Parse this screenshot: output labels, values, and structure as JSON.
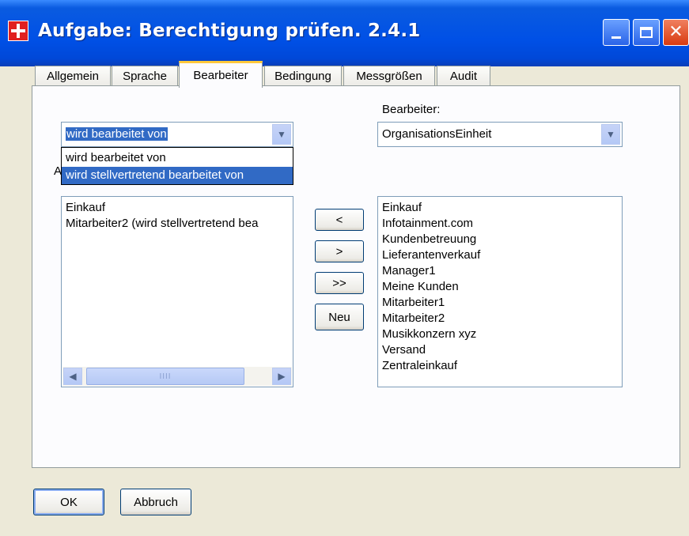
{
  "window": {
    "title": "Aufgabe: Berechtigung prüfen. 2.4.1",
    "controls": {
      "minimize_icon": "minimize-icon",
      "maximize_icon": "maximize-icon",
      "close_icon": "close-icon",
      "close_glyph": "✕"
    }
  },
  "tabs": [
    {
      "label": "Allgemein",
      "active": false
    },
    {
      "label": "Sprache",
      "active": false
    },
    {
      "label": "Bearbeiter",
      "active": true
    },
    {
      "label": "Bedingung",
      "active": false
    },
    {
      "label": "Messgrößen",
      "active": false
    },
    {
      "label": "Audit",
      "active": false
    }
  ],
  "relation_combo": {
    "value": "wird bearbeitet von",
    "options": [
      "wird bearbeitet von",
      "wird stellvertretend bearbeitet von"
    ],
    "highlighted_option": 1
  },
  "hidden_label_char": "A",
  "bearbeiter": {
    "label": "Bearbeiter:",
    "combo_value": "OrganisationsEinheit"
  },
  "assigned_list": {
    "items": [
      "Einkauf",
      "Mitarbeiter2 (wird stellvertretend bea"
    ],
    "scroll_thumb_grip": "IIII"
  },
  "transfer_buttons": {
    "left": "<",
    "right": ">",
    "all_right": ">>",
    "new": "Neu"
  },
  "available_list": {
    "items": [
      "Einkauf",
      "Infotainment.com",
      "Kundenbetreuung",
      "Lieferantenverkauf",
      "Manager1",
      "Meine Kunden",
      "Mitarbeiter1",
      "Mitarbeiter2",
      "Musikkonzern xyz",
      "Versand",
      "Zentraleinkauf"
    ]
  },
  "footer": {
    "ok": "OK",
    "cancel": "Abbruch"
  },
  "colors": {
    "titlebar": "#0050e6",
    "selection": "#316ac5",
    "active_tab_accent": "#ffc83c",
    "close_button": "#d83a10"
  }
}
